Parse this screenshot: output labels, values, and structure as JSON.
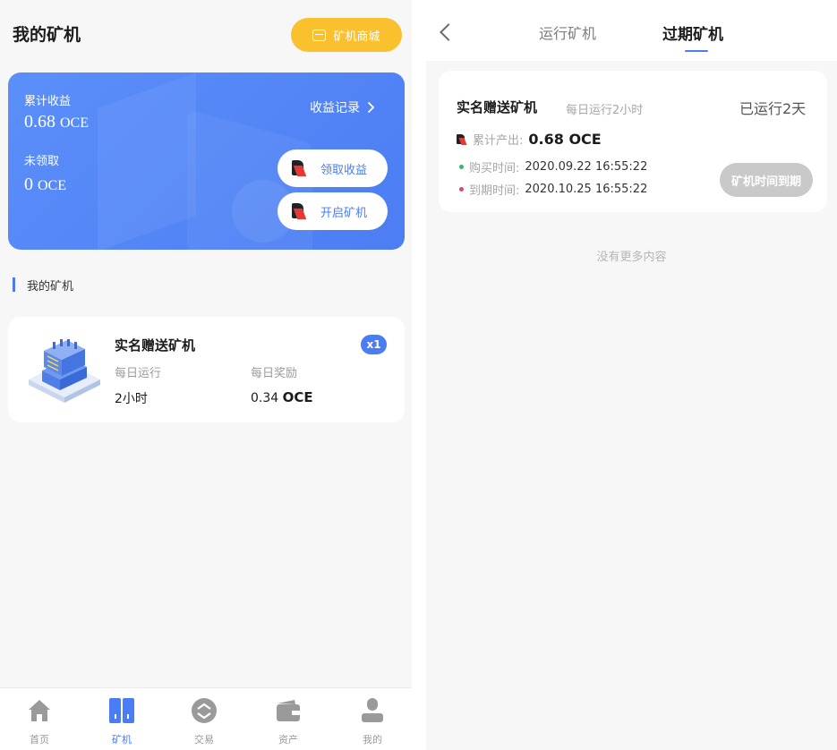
{
  "left": {
    "title": "我的矿机",
    "shop_button": "矿机商城",
    "earnings": {
      "total_label": "累计收益",
      "total_value": "0.68",
      "total_unit": "OCE",
      "unclaimed_label": "未领取",
      "unclaimed_value": "0",
      "unclaimed_unit": "OCE",
      "record_link": "收益记录",
      "claim_button": "领取收益",
      "start_button": "开启矿机"
    },
    "section_title": "我的矿机",
    "miner": {
      "name": "实名赠送矿机",
      "count_badge": "x1",
      "daily_run_label": "每日运行",
      "daily_run_value": "2小时",
      "daily_reward_label": "每日奖励",
      "daily_reward_value": "0.34",
      "daily_reward_unit": "OCE"
    },
    "tabbar": [
      {
        "label": "首页",
        "icon": "home-icon"
      },
      {
        "label": "矿机",
        "icon": "miner-icon"
      },
      {
        "label": "交易",
        "icon": "trade-icon"
      },
      {
        "label": "资产",
        "icon": "wallet-icon"
      },
      {
        "label": "我的",
        "icon": "user-icon"
      }
    ]
  },
  "right": {
    "tabs": [
      "运行矿机",
      "过期矿机"
    ],
    "active_tab": "过期矿机",
    "expired_miner": {
      "name": "实名赠送矿机",
      "daily": "每日运行2小时",
      "ran": "已运行2天",
      "total_label": "累计产出:",
      "total_value": "0.68 OCE",
      "purchase_label": "购买时间:",
      "purchase_value": "2020.09.22 16:55:22",
      "expire_label": "到期时间:",
      "expire_value": "2020.10.25 16:55:22",
      "status_button": "矿机时间到期"
    },
    "no_more": "没有更多内容"
  },
  "colors": {
    "accent": "#4a7cf3",
    "shop": "#fbc02d",
    "green_dot": "#2dbb6a",
    "red_dot": "#e0407a",
    "expired": "#c9c9c9"
  }
}
